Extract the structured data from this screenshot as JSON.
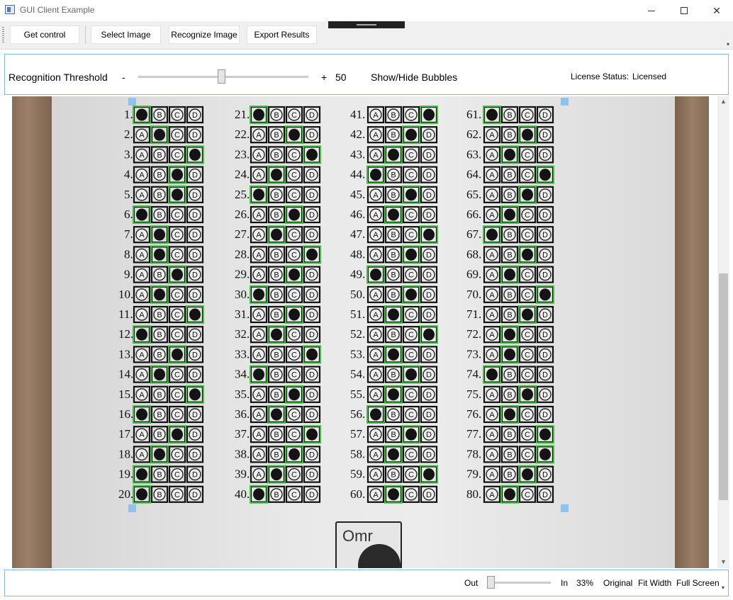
{
  "window": {
    "title": "GUI Client Example",
    "icon": "app-window-icon"
  },
  "toolbar": {
    "get_control": "Get control",
    "select_image": "Select Image",
    "recognize_image": "Recognize Image",
    "export_results": "Export Results"
  },
  "threshold": {
    "label": "Recognition Threshold",
    "minus": "-",
    "plus": "+",
    "value": "50",
    "slider_fraction": 0.5,
    "show_hide_bubbles": "Show/Hide Bubbles"
  },
  "license": {
    "label": "License Status:",
    "value": "Licensed"
  },
  "zoom": {
    "out": "Out",
    "in": "In",
    "percent": "33%",
    "original": "Original",
    "fit_width": "Fit Width",
    "full_screen": "Full Screen"
  },
  "sheet": {
    "letters": [
      "A",
      "B",
      "C",
      "D"
    ],
    "highlight_color": "#3cc43c",
    "columns": [
      {
        "answers": [
          "A",
          "B",
          "D",
          "C",
          "C",
          "A",
          "B",
          "B",
          "C",
          "B",
          "D",
          "A",
          "C",
          "B",
          "D",
          "A",
          "C",
          "B",
          "A",
          "A"
        ]
      },
      {
        "answers": [
          "A",
          "C",
          "D",
          "B",
          "A",
          "C",
          "B",
          "D",
          "C",
          "A",
          "C",
          "B",
          "D",
          "A",
          "C",
          "B",
          "D",
          "C",
          "B",
          "A"
        ]
      },
      {
        "answers": [
          "D",
          "C",
          "B",
          "A",
          "C",
          "B",
          "D",
          "C",
          "A",
          "C",
          "B",
          "D",
          "B",
          "C",
          "B",
          "A",
          "C",
          "B",
          "D",
          "B"
        ]
      },
      {
        "answers": [
          "A",
          "C",
          "B",
          "D",
          "C",
          "B",
          "A",
          "C",
          "B",
          "D",
          "C",
          "B",
          "B",
          "A",
          "C",
          "B",
          "D",
          "D",
          "C",
          "B"
        ]
      }
    ],
    "logo_text": "Omr"
  },
  "icons": {
    "minimize": "minimize-icon",
    "maximize": "maximize-icon",
    "close": "close-icon",
    "scroll_up": "chevron-up-icon",
    "scroll_down": "chevron-down-icon"
  }
}
